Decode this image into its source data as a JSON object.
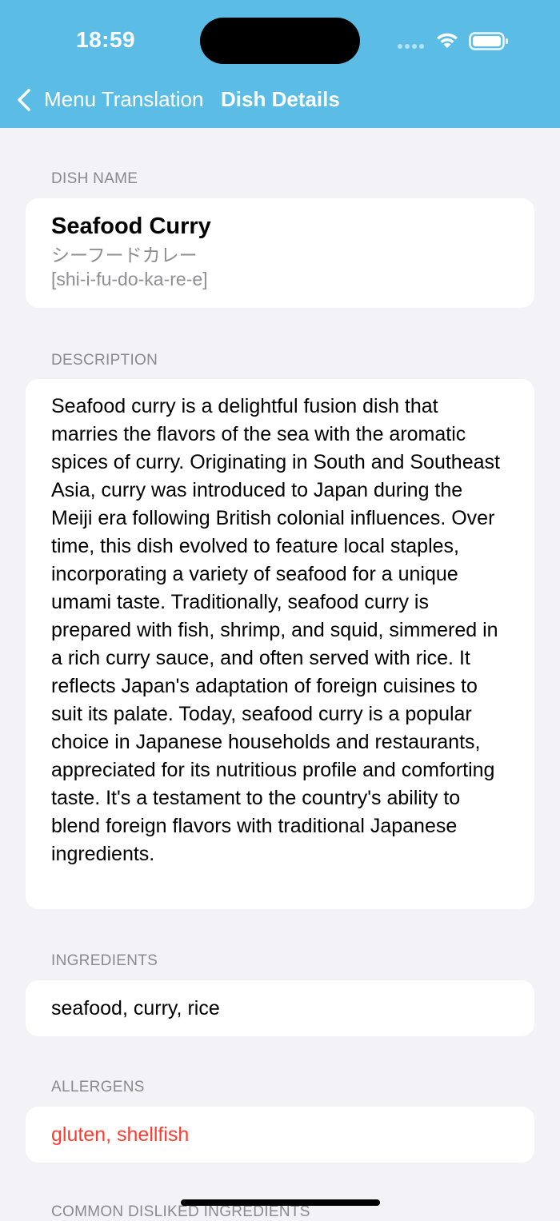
{
  "status_bar": {
    "time": "18:59"
  },
  "nav": {
    "back_label": "Menu Translation",
    "title": "Dish Details"
  },
  "dish_name": {
    "header": "DISH NAME",
    "name": "Seafood Curry",
    "japanese": "シーフードカレー",
    "romaji": "[shi-i-fu-do-ka-re-e]"
  },
  "description": {
    "header": "DESCRIPTION",
    "text": "Seafood curry is a delightful fusion dish that marries the flavors of the sea with the aromatic spices of curry. Originating in South and Southeast Asia, curry was introduced to Japan during the Meiji era following British colonial influences. Over time, this dish evolved to feature local staples, incorporating a variety of seafood for a unique umami taste. Traditionally, seafood curry is prepared with fish, shrimp, and squid, simmered in a rich curry sauce, and often served with rice. It reflects Japan's adaptation of foreign cuisines to suit its palate. Today, seafood curry is a popular choice in Japanese households and restaurants, appreciated for its nutritious profile and comforting taste. It's a testament to the country's ability to blend foreign flavors with traditional Japanese ingredients."
  },
  "ingredients": {
    "header": "INGREDIENTS",
    "text": "seafood, curry, rice"
  },
  "allergens": {
    "header": "ALLERGENS",
    "text": "gluten, shellfish"
  },
  "disliked": {
    "header": "COMMON DISLIKED INGREDIENTS"
  },
  "colors": {
    "nav_bar": "#5bbde6",
    "allergen": "#ff3b30",
    "background": "#f2f2f7"
  }
}
